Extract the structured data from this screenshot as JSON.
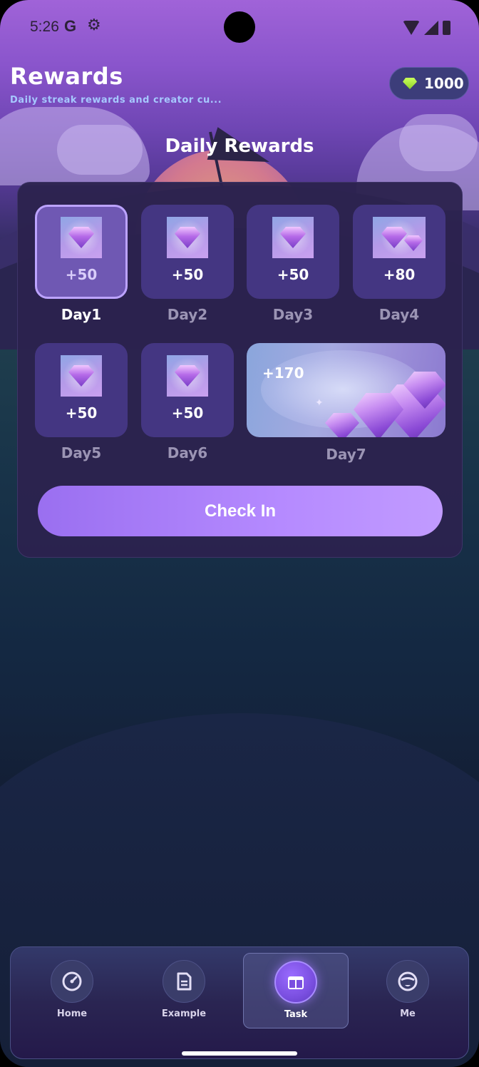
{
  "status_bar": {
    "time": "5:26",
    "google_glyph": "G",
    "settings_icon": "gear-icon"
  },
  "header": {
    "title": "Rewards",
    "subtitle": "Daily streak rewards and creator cu...",
    "coins": "1000"
  },
  "section_title": "Daily Rewards",
  "days": [
    {
      "label": "Day1",
      "amount": "+50",
      "state": "current"
    },
    {
      "label": "Day2",
      "amount": "+50",
      "state": "upcoming"
    },
    {
      "label": "Day3",
      "amount": "+50",
      "state": "upcoming"
    },
    {
      "label": "Day4",
      "amount": "+80",
      "state": "upcoming"
    },
    {
      "label": "Day5",
      "amount": "+50",
      "state": "upcoming"
    },
    {
      "label": "Day6",
      "amount": "+50",
      "state": "upcoming"
    },
    {
      "label": "Day7",
      "amount": "+170",
      "state": "upcoming"
    }
  ],
  "check_in_label": "Check In",
  "nav": {
    "items": [
      {
        "label": "Home",
        "icon": "speedometer-icon"
      },
      {
        "label": "Example",
        "icon": "document-icon"
      },
      {
        "label": "Task",
        "icon": "gift-box-icon",
        "active": true
      },
      {
        "label": "Me",
        "icon": "user-face-icon"
      }
    ]
  },
  "colors": {
    "accent": "#b58aff",
    "coin_gem": "#a8ea3a",
    "subtitle": "#a6c8ff"
  }
}
